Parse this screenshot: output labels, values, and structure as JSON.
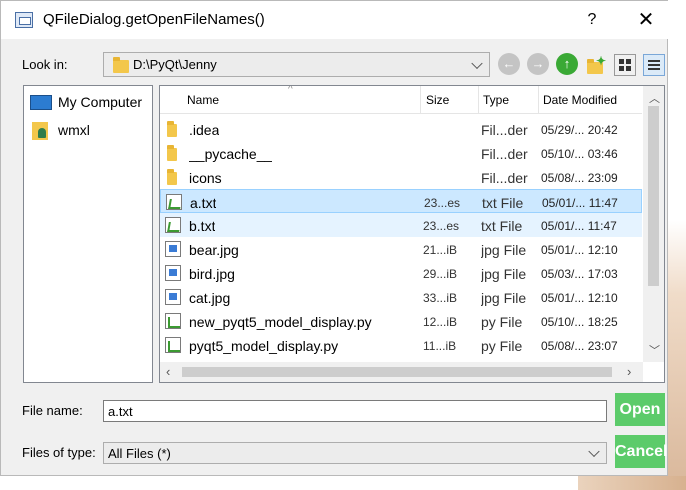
{
  "window": {
    "title": "QFileDialog.getOpenFileNames()",
    "help_label": "?",
    "close_label": "✕"
  },
  "look_in": {
    "label": "Look in:",
    "path": "D:\\PyQt\\Jenny"
  },
  "toolbar": {
    "back_icon": "back-arrow-icon",
    "forward_icon": "forward-arrow-icon",
    "up_icon": "up-arrow-icon",
    "new_folder_icon": "new-folder-icon",
    "list_view_icon": "list-view-icon",
    "detail_view_icon": "detail-view-icon",
    "nav_color": "#c4c4c4",
    "up_color": "#3aa935"
  },
  "sidebar": {
    "items": [
      {
        "label": "My Computer",
        "icon": "computer-icon"
      },
      {
        "label": "wmxl",
        "icon": "user-folder-icon"
      }
    ]
  },
  "columns": {
    "name": "Name",
    "size": "Size",
    "type": "Type",
    "date": "Date Modified"
  },
  "files": [
    {
      "name": ".idea",
      "size": "",
      "type": "Fil...der",
      "date": "05/29/... 20:42",
      "icon": "folder-icon"
    },
    {
      "name": "__pycache__",
      "size": "",
      "type": "Fil...der",
      "date": "05/10/... 03:46",
      "icon": "folder-icon"
    },
    {
      "name": "icons",
      "size": "",
      "type": "Fil...der",
      "date": "05/08/... 23:09",
      "icon": "folder-icon"
    },
    {
      "name": "a.txt",
      "size": "23...es",
      "type": "txt File",
      "date": "05/01/... 11:47",
      "icon": "txt-file-icon",
      "state": "selected"
    },
    {
      "name": "b.txt",
      "size": "23...es",
      "type": "txt File",
      "date": "05/01/... 11:47",
      "icon": "txt-file-icon",
      "state": "hover"
    },
    {
      "name": "bear.jpg",
      "size": "21...iB",
      "type": "jpg File",
      "date": "05/01/... 12:10",
      "icon": "image-file-icon"
    },
    {
      "name": "bird.jpg",
      "size": "29...iB",
      "type": "jpg File",
      "date": "05/03/... 17:03",
      "icon": "image-file-icon"
    },
    {
      "name": "cat.jpg",
      "size": "33...iB",
      "type": "jpg File",
      "date": "05/01/... 12:10",
      "icon": "image-file-icon"
    },
    {
      "name": "new_pyqt5_model_display.py",
      "size": "12...iB",
      "type": "py File",
      "date": "05/10/... 18:25",
      "icon": "py-file-icon"
    },
    {
      "name": "pyqt5_model_display.py",
      "size": "11...iB",
      "type": "py File",
      "date": "05/08/... 23:07",
      "icon": "py-file-icon"
    }
  ],
  "file_name": {
    "label": "File name:",
    "value": "a.txt"
  },
  "file_type": {
    "label": "Files of type:",
    "value": "All Files (*)"
  },
  "buttons": {
    "open": "Open",
    "cancel": "Cancel",
    "color": "#5ccb6a"
  }
}
